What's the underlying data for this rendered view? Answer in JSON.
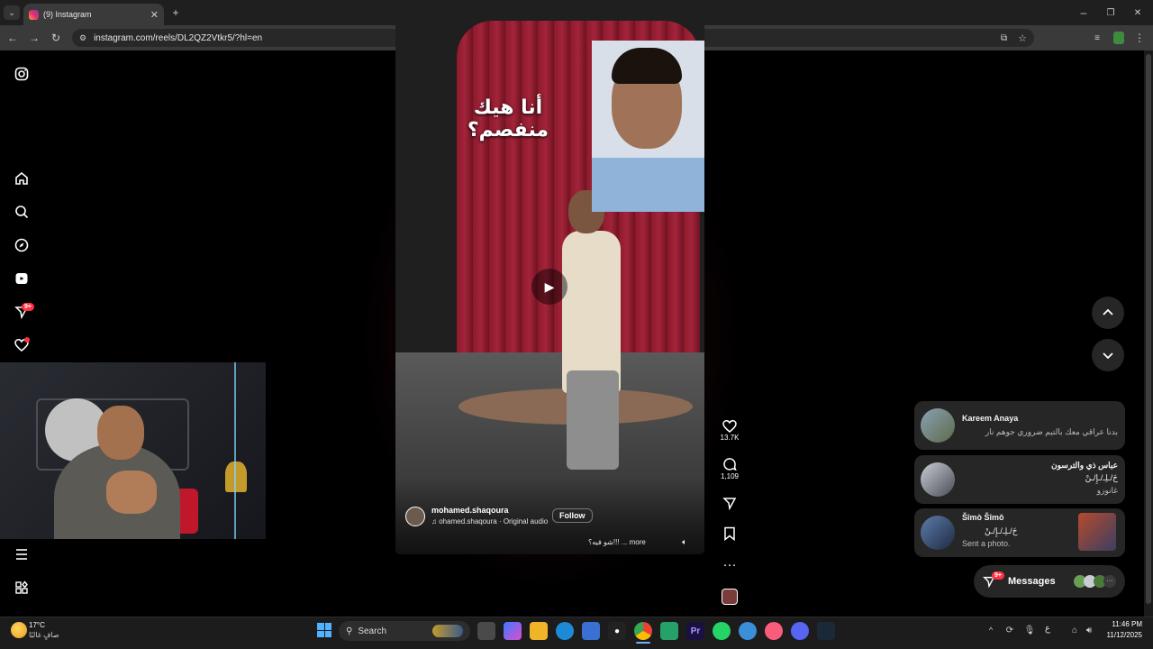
{
  "browser": {
    "tab_title": "(9) Instagram",
    "url": "instagram.com/reels/DL2QZ2Vtkr5/?hl=en",
    "window_controls": {
      "minimize": "–",
      "restore": "❐",
      "close": "✕"
    }
  },
  "sidebar": {
    "items": [
      {
        "icon": "instagram-logo-icon"
      },
      {
        "icon": "home-icon"
      },
      {
        "icon": "search-icon"
      },
      {
        "icon": "explore-icon"
      },
      {
        "icon": "reels-icon"
      },
      {
        "icon": "messages-icon",
        "badge": "9+"
      },
      {
        "icon": "notifications-icon"
      },
      {
        "icon": "more-menu-icon"
      },
      {
        "icon": "also-from-meta-icon"
      }
    ]
  },
  "reel": {
    "caption_overlay": "أنا هيك منفصم؟",
    "username": "mohamed.shaqoura",
    "audio": "ohamed.shaqoura · Original audio",
    "follow_label": "Follow",
    "description": "شو فيه؟!!! ... more"
  },
  "actions": {
    "likes": "13.7K",
    "comments": "1,109"
  },
  "notifications": [
    {
      "name": "Kareem Anaya",
      "message": "بدنا عراقي معك بالتيم ضروري جوهم نار"
    },
    {
      "name": "عباس ذي والترسون",
      "message": "خَ/ـلِـ/ـإِ/ـنْ",
      "sub": "غانوزو"
    },
    {
      "name": "Šîmò Šîmô",
      "message": "خَ/ـلِـ/ـإِ/ـنْ",
      "sub": "Sent a photo."
    }
  ],
  "messages_pill": {
    "label": "Messages",
    "badge": "9+"
  },
  "taskbar": {
    "weather_temp": "17°C",
    "weather_desc": "صافٍ غالبًا",
    "search_placeholder": "Search",
    "lang": "ع",
    "time": "11:46 PM",
    "date": "11/12/2025"
  },
  "colors": {
    "accent": "#0095f6",
    "badge": "#ff3040",
    "curtain": "#8b1a2b"
  }
}
